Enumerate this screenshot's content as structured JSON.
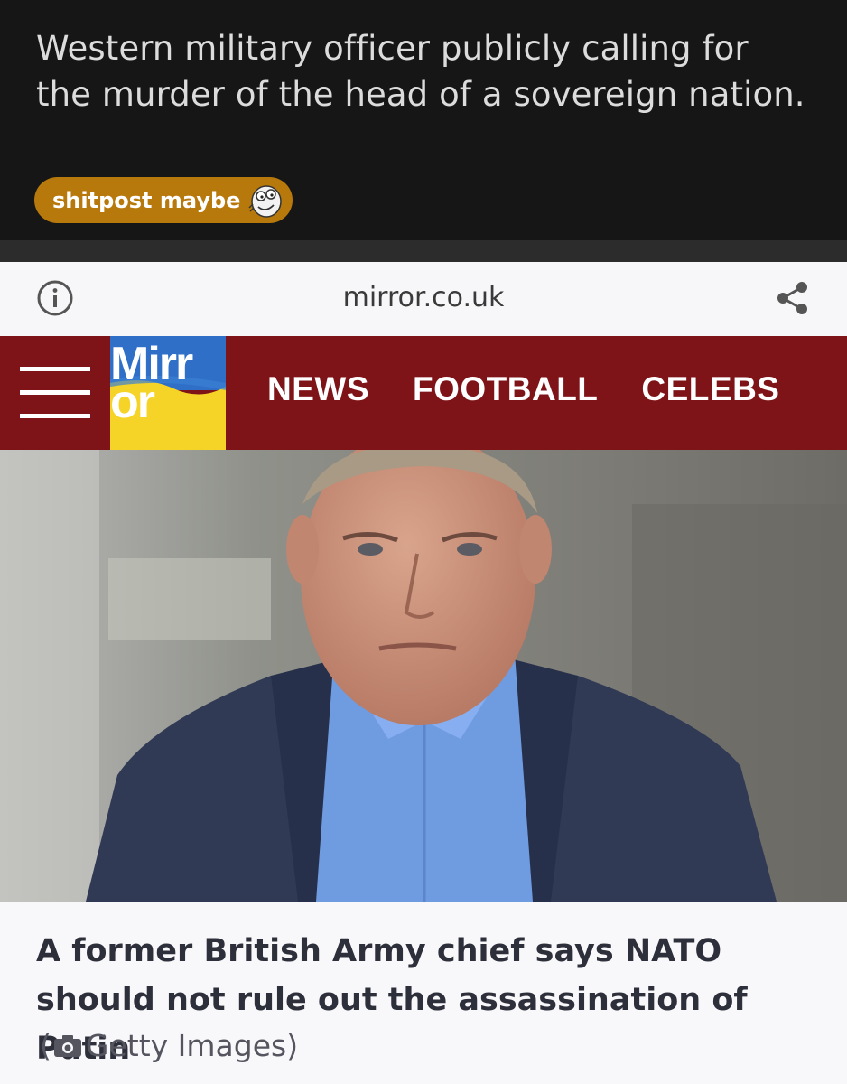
{
  "post": {
    "title": "Western military officer publicly calling for the murder of the head of a sovereign nation.",
    "flair": {
      "label": "shitpost maybe",
      "emoji": "derp-face-emoji",
      "color": "#b8790c"
    }
  },
  "browser": {
    "url": "mirror.co.uk",
    "info_icon": "info-icon",
    "share_icon": "share-icon"
  },
  "site_nav": {
    "logo_line1": "Mirr",
    "logo_line2": "or",
    "brand_color": "#7e1418",
    "links": [
      "NEWS",
      "FOOTBALL",
      "CELEBS"
    ]
  },
  "article": {
    "headline": "A former British Army chief says NATO should not rule out the assassination of Putin",
    "credit_open": "(",
    "credit_text": "Getty Images)"
  }
}
